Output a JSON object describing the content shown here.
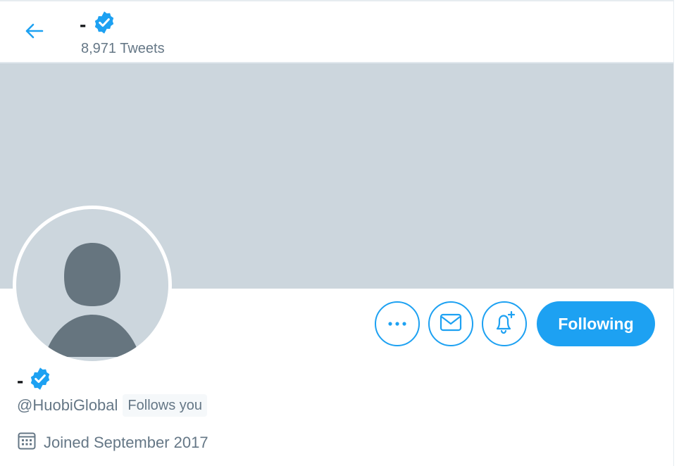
{
  "header": {
    "back_icon": "arrow-left-icon",
    "name": "-",
    "tweet_count": "8,971 Tweets"
  },
  "profile": {
    "display_name": "-",
    "handle": "@HuobiGlobal",
    "follows_you_label": "Follows you",
    "joined": "Joined September 2017",
    "verified_icon": "verified-badge-icon",
    "calendar_icon": "calendar-icon"
  },
  "actions": {
    "more_icon": "more-dots-icon",
    "message_icon": "envelope-icon",
    "notify_icon": "bell-plus-icon",
    "following_label": "Following"
  },
  "colors": {
    "accent": "#1da1f2",
    "banner": "#ccd6dd",
    "muted_text": "#657786",
    "avatar_silhouette": "#66757f"
  }
}
